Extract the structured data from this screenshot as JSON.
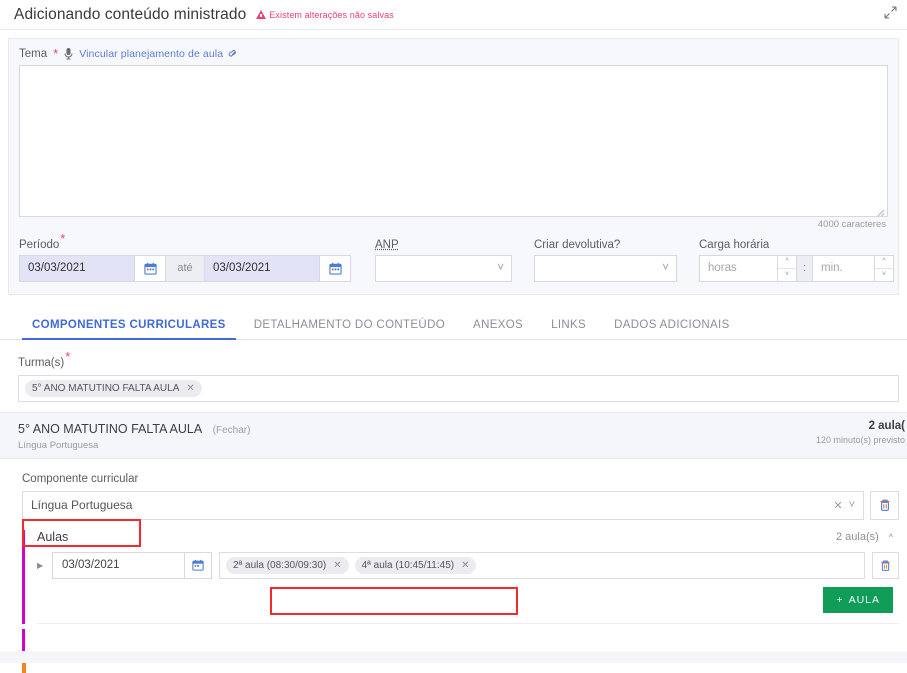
{
  "header": {
    "title": "Adicionando conteúdo ministrado",
    "unsaved_warning": "Existem alterações não salvas",
    "warn_icon": "warning-triangle-icon",
    "expand_icon": "expand-diagonal-icon",
    "warn_color": "#f0426c"
  },
  "tema": {
    "label": "Tema",
    "required_mark": "*",
    "mic_icon": "microphone-icon",
    "link_label": "Vincular planejamento de aula",
    "chain_icon": "chain-link-icon",
    "value": "",
    "char_counter": "4000 caracteres",
    "resize_icon": "resize-grip-icon"
  },
  "periodo": {
    "label": "Período",
    "required_mark": "*",
    "start_date": "03/03/2021",
    "end_date": "03/03/2021",
    "between_label": "até",
    "calendar_icon": "calendar-icon"
  },
  "anp": {
    "label": "ANP",
    "value": "",
    "chevron_icon": "chevron-down-icon"
  },
  "devolutiva": {
    "label": "Criar devolutiva?",
    "value": "",
    "chevron_icon": "chevron-down-icon"
  },
  "carga_horaria": {
    "label": "Carga horária",
    "hours_placeholder": "horas",
    "hours_value": "",
    "separator": ":",
    "minutes_placeholder": "min.",
    "minutes_value": "",
    "up_icon": "chevron-up-icon",
    "down_icon": "chevron-down-icon"
  },
  "tabs": [
    {
      "label": "COMPONENTES CURRICULARES",
      "active": true
    },
    {
      "label": "DETALHAMENTO DO CONTEÚDO",
      "active": false
    },
    {
      "label": "ANEXOS",
      "active": false
    },
    {
      "label": "LINKS",
      "active": false
    },
    {
      "label": "DADOS ADICIONAIS",
      "active": false
    }
  ],
  "turmas": {
    "label": "Turma(s)",
    "required_mark": "*",
    "chips": [
      {
        "label": "5° ANO MATUTINO FALTA AULA",
        "remove_icon": "close-x-icon"
      }
    ]
  },
  "accordion": {
    "title": "5° ANO MATUTINO FALTA AULA",
    "toggle_label": "(Fechar)",
    "subtitle": "Língua Portuguesa",
    "count_label": "2 aula(",
    "duration_label": "120 minuto(s) previsto"
  },
  "componente": {
    "label": "Componente curricular",
    "value": "Língua Portuguesa",
    "clear_icon": "close-x-icon",
    "chevron_icon": "chevron-down-icon",
    "delete_icon": "trash-icon"
  },
  "aulas": {
    "title": "Aulas",
    "count_label": "2 aula(s)",
    "collapse_icon": "chevron-up-icon",
    "expand_row_icon": "triangle-right-icon",
    "date": "03/03/2021",
    "calendar_icon": "calendar-icon",
    "chips": [
      {
        "label": "2ª aula (08:30/09:30)",
        "remove_icon": "close-x-icon"
      },
      {
        "label": "4ª aula (10:45/11:45)",
        "remove_icon": "close-x-icon"
      }
    ],
    "delete_icon": "trash-icon",
    "add_button": "AULA",
    "add_icon": "plus-icon",
    "add_button_color": "#0f9d58",
    "accent_bar_color": "#d400c8",
    "secondary_bar_color": "#f5861f"
  },
  "annotations": {
    "highlight_color": "#ef2b2b",
    "boxes": [
      "componente-curricular-value",
      "aula-chips"
    ]
  }
}
